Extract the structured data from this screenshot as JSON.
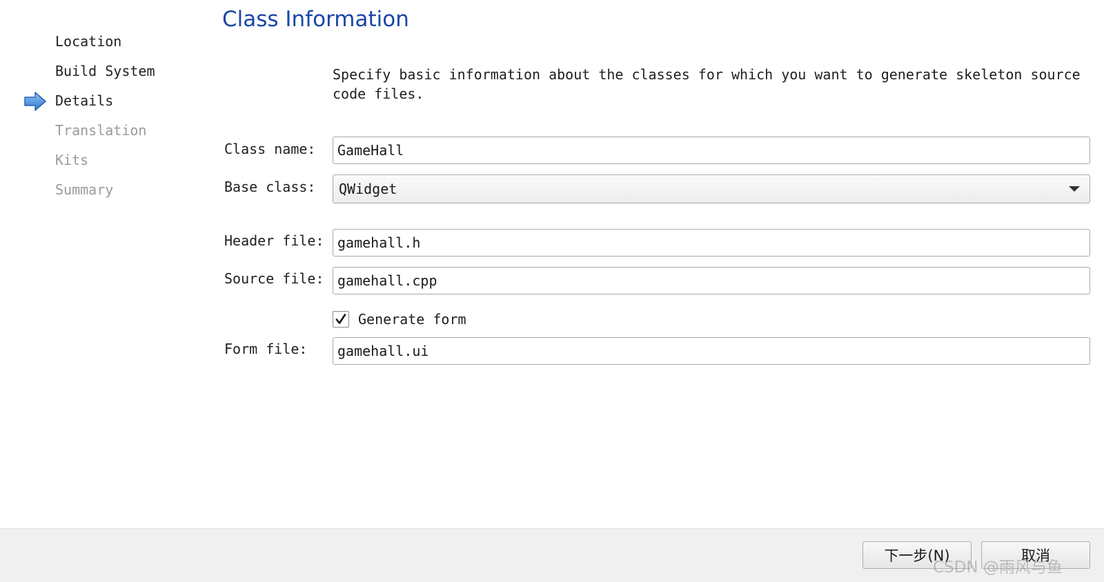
{
  "sidebar": {
    "steps": [
      {
        "label": "Location"
      },
      {
        "label": "Build System"
      },
      {
        "label": "Details"
      },
      {
        "label": "Translation"
      },
      {
        "label": "Kits"
      },
      {
        "label": "Summary"
      }
    ],
    "current_step": "Details"
  },
  "header": {
    "title": "Class Information"
  },
  "description": "Specify basic information about the classes for which you want to generate skeleton source code files.",
  "form": {
    "class_name": {
      "label": "Class name:",
      "value": "GameHall"
    },
    "base_class": {
      "label": "Base class:",
      "value": "QWidget"
    },
    "header_file": {
      "label": "Header file:",
      "value": "gamehall.h"
    },
    "source_file": {
      "label": "Source file:",
      "value": "gamehall.cpp"
    },
    "generate_form": {
      "label": "Generate form",
      "checked": true
    },
    "form_file": {
      "label": "Form file:",
      "value": "gamehall.ui"
    }
  },
  "footer": {
    "next_label": "下一步(N)",
    "cancel_label": "取消",
    "watermark": "CSDN @雨风与鱼"
  },
  "colors": {
    "title": "#1a46a8",
    "arrow": "#3b82d6",
    "pending_step": "#9a9a9a"
  }
}
